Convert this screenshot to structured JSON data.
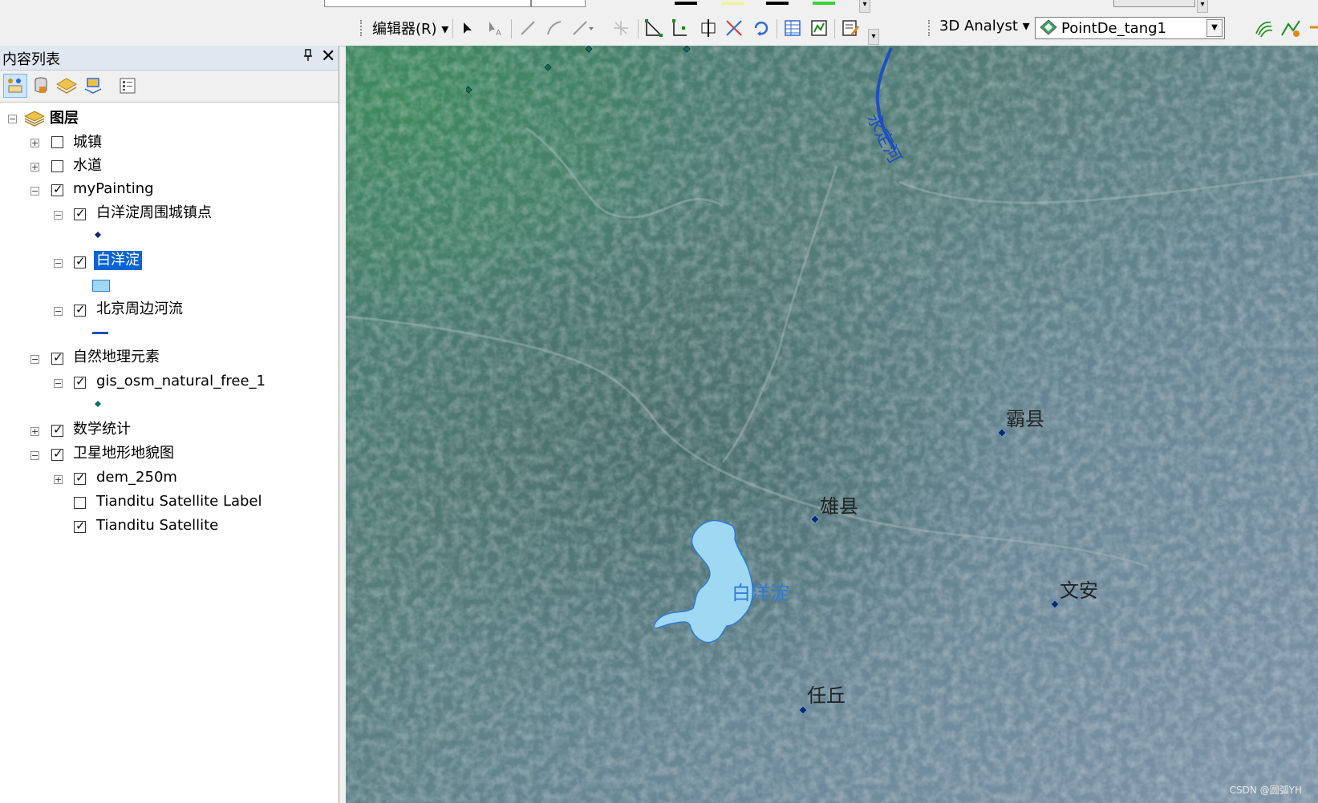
{
  "toolbar": {
    "editor_label": "编辑器(R)",
    "analyst_label": "3D Analyst",
    "layer_select_value": "PointDe_tang1"
  },
  "toc": {
    "title": "内容列表",
    "pin": "ᵽ",
    "close": "✕",
    "root_label": "图层",
    "layers": [
      {
        "label": "城镇",
        "checked": false
      },
      {
        "label": "水道",
        "checked": false
      },
      {
        "label": "myPainting",
        "checked": true
      },
      {
        "label": "白洋淀周围城镇点",
        "checked": true
      },
      {
        "label": "白洋淀",
        "checked": true,
        "selected": true
      },
      {
        "label": "北京周边河流",
        "checked": true
      },
      {
        "label": "自然地理元素",
        "checked": true
      },
      {
        "label": "gis_osm_natural_free_1",
        "checked": true
      },
      {
        "label": "数学统计",
        "checked": true
      },
      {
        "label": "卫星地形地貌图",
        "checked": true
      },
      {
        "label": "dem_250m",
        "checked": true
      },
      {
        "label": "Tianditu Satellite Label",
        "checked": false
      },
      {
        "label": "Tianditu Satellite",
        "checked": true
      }
    ]
  },
  "map": {
    "labels": {
      "river": "永定河",
      "bazhou": "霸县",
      "xiongxian": "雄县",
      "lake": "白洋淀",
      "wenan": "文安",
      "renqiu": "任丘"
    },
    "watermark": "CSDN @圆弧YH",
    "colors": {
      "lake_fill": "#9ed8f3",
      "lake_outline": "#2d7bd6",
      "river": "#1f4fbf",
      "point": "#0b2a6b",
      "natural_point": "#0c7060",
      "selection": "#0a64d2"
    }
  }
}
